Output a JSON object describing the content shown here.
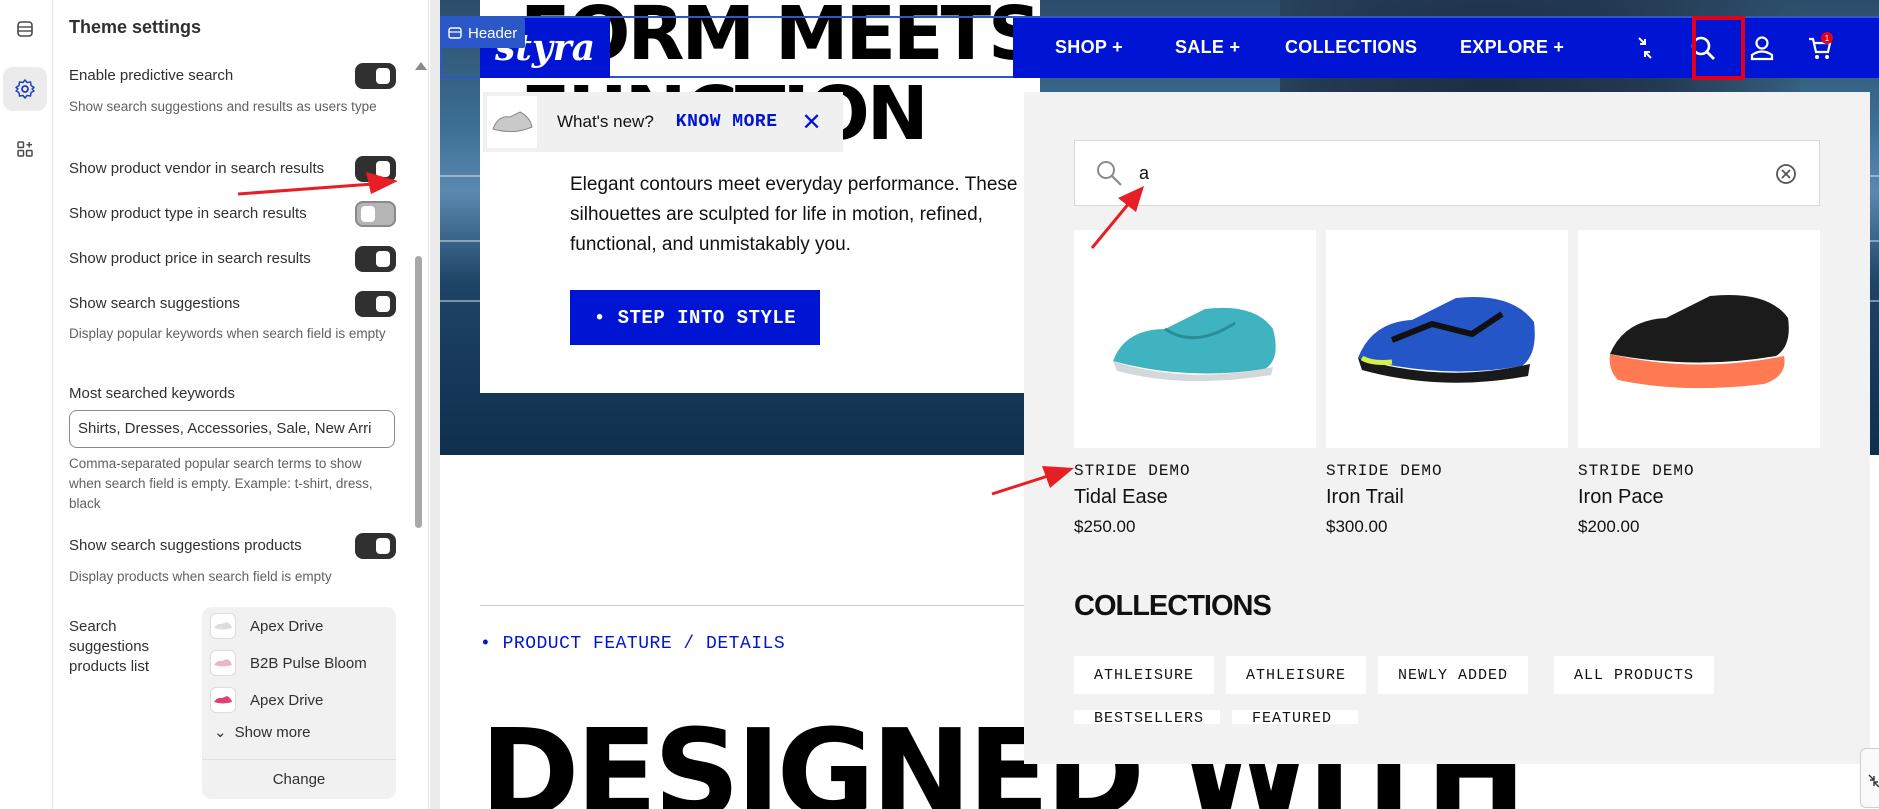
{
  "sidebar": {
    "title": "Theme settings",
    "rows": [
      {
        "label": "Enable predictive search",
        "help": "Show search suggestions and results as users type",
        "on": true
      },
      {
        "label": "Show product vendor in search results",
        "on": true
      },
      {
        "label": "Show product type in search results",
        "on": false
      },
      {
        "label": "Show product price in search results",
        "on": true
      },
      {
        "label": "Show search suggestions",
        "help": "Display popular keywords when search field is empty",
        "on": true
      }
    ],
    "keywords": {
      "label": "Most searched keywords",
      "value": "Shirts, Dresses, Accessories, Sale, New Arri",
      "help": "Comma-separated popular search terms to show when search field is empty. Example: t-shirt, dress, black"
    },
    "suggest_products": {
      "label": "Show search suggestions products",
      "help": "Display products when search field is empty",
      "on": true
    },
    "products_list": {
      "label": "Search suggestions products list",
      "items": [
        "Apex Drive",
        "B2B Pulse Bloom",
        "Apex Drive"
      ],
      "show_more": "Show more",
      "change": "Change"
    }
  },
  "preview": {
    "header_tag": "Header",
    "logo": "styra",
    "nav": [
      "SHOP +",
      "SALE +",
      "COLLECTIONS",
      "EXPLORE +"
    ],
    "cart_count": "1",
    "hero": {
      "title_1": "FORM MEETS",
      "title_2": "FUNCTION",
      "whats_new": "What's new?",
      "know_more": "KNOW MORE",
      "close": "✕",
      "description": "Elegant contours meet everyday performance. These silhouettes are sculpted for life in motion, refined, functional, and unmistakably you.",
      "cta": "• STEP INTO STYLE"
    },
    "feature_label": "• PRODUCT FEATURE / DETAILS",
    "big_title": "DESIGNED WITH",
    "search": {
      "query": "a",
      "products": [
        {
          "vendor": "STRIDE DEMO",
          "name": "Tidal Ease",
          "price": "$250.00"
        },
        {
          "vendor": "STRIDE DEMO",
          "name": "Iron Trail",
          "price": "$300.00"
        },
        {
          "vendor": "STRIDE DEMO",
          "name": "Iron Pace",
          "price": "$200.00"
        }
      ],
      "collections_title": "COLLECTIONS",
      "collections": [
        "ATHLEISURE",
        "ATHLEISURE",
        "NEWLY ADDED",
        "ALL PRODUCTS"
      ],
      "collections_cut": [
        "BESTSELLERS",
        "FEATURED"
      ]
    }
  },
  "colors": {
    "brand_blue": "#0014d4",
    "highlight_red": "#e3001b",
    "toggle_on": "#303030"
  }
}
